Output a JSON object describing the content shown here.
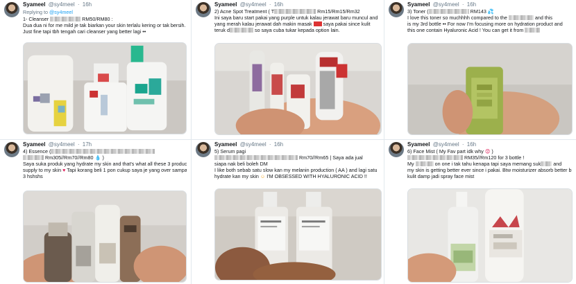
{
  "tweets": [
    {
      "name": "Syameel",
      "handle": "@sy4meel",
      "time": "16h",
      "reply_prefix": "Replying to",
      "reply_to": "@sy4meel",
      "lines": [
        "1- Cleanser",
        "RM50/RM80 :",
        "",
        "Dua dua ni for me mild je tak biarkan your skin terlalu kering or tak bersih.",
        "Just fine tapi tbh tengah cari cleanser yang better lagi ••"
      ]
    },
    {
      "name": "Syameel",
      "handle": "@sy4meel",
      "time": "16h",
      "lines": [
        "2) Acne Spot Treatment ( T",
        "Rm15/Rm15/Rm32",
        "",
        "Ini saya baru start pakai yang purple untuk kalau jerawat baru muncul and",
        "yang merah kalau jerawat dah makin masak",
        "saya pakai since kulit",
        "teruk d",
        "so saya cuba tukar kepada option lain."
      ]
    },
    {
      "name": "Syameel",
      "handle": "@sy4meel",
      "time": "16h",
      "lines": [
        "3) Toner (",
        "RM143",
        "",
        "I love this toner so muchhhh compared to the",
        "and this",
        "is my 3rd bottle •• For now I'm focusing more on hydration product and",
        "this one contain Hyaluronic Acid ! You can get it from"
      ]
    },
    {
      "name": "Syameel",
      "handle": "@sy4meel",
      "time": "17h",
      "lines": [
        "4) Essence (",
        "Rm305//Rm70//Rm80",
        "",
        "Saya suka produk yang hydrate my skin and that's what all these 3 product",
        "supply to my skin",
        "Tapi korang beli 1 pon cukup saya je yang over sampai",
        "3 hshshs"
      ]
    },
    {
      "name": "Syameel",
      "handle": "@sy4meel",
      "time": "16h",
      "lines": [
        "5) Serum pagi",
        "Rm70//Rm65 | Saya ada jual",
        "siapa nak beli boleh DM",
        "",
        "I like both sebab satu slow kan my melanin production ( AA ) and lagi satu",
        "hydrate kan my skin",
        "I'M OBSESSED WITH HYALURONIC ACID !!"
      ]
    },
    {
      "name": "Syameel",
      "handle": "@sy4meel",
      "time": "16h",
      "lines": [
        "6) Face Mist ( My Fav part idk why",
        ")",
        "RM35//Rm120 for 3 bottle !",
        "",
        "My",
        "on one i tak tahu kenapa tapi saya memang suk",
        "and",
        "my skin is getting better ever since i pakai. Btw moisturizer absorb better bila",
        "kulit damp jadi spray face mist"
      ]
    }
  ]
}
